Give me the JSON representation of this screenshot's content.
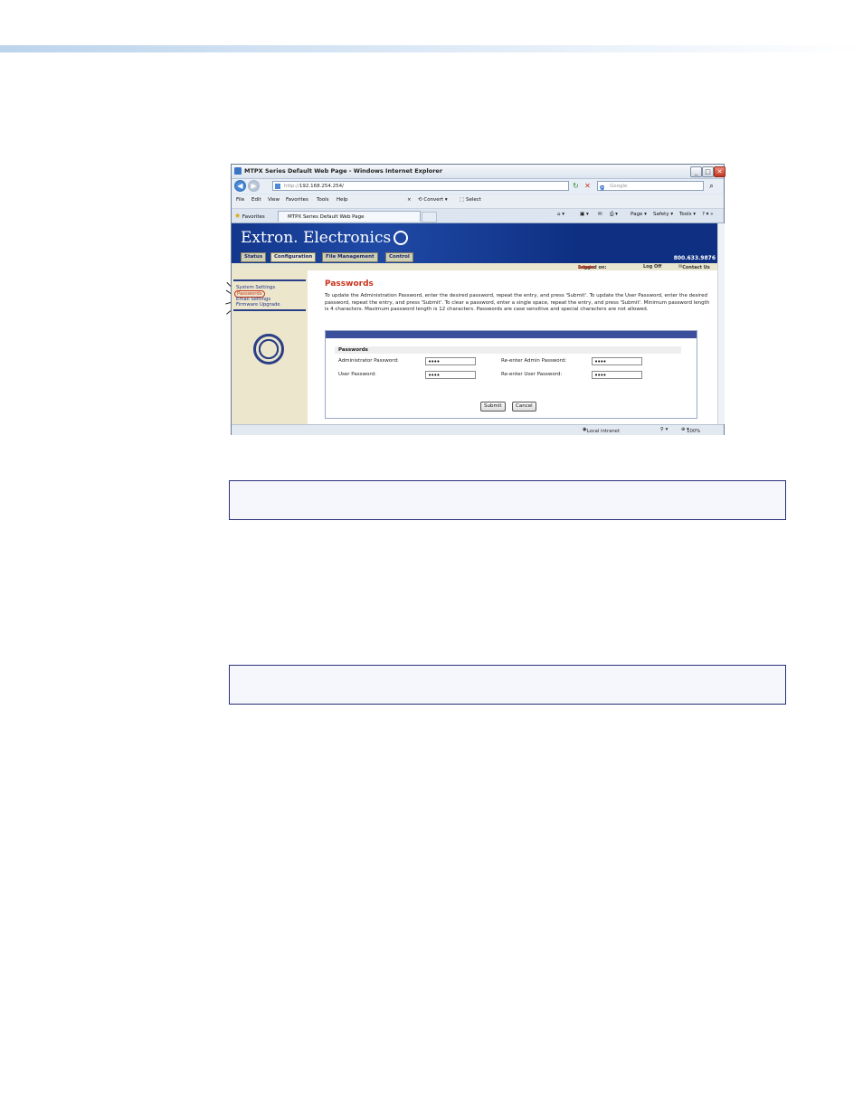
{
  "window": {
    "title": "MTPX Series Default Web Page - Windows Internet Explorer",
    "controls": {
      "minimize": "_",
      "maximize": "□",
      "close": "✕"
    }
  },
  "address_bar": {
    "url_prefix": "http://",
    "url": "192.168.254.254/",
    "search_placeholder": "Google"
  },
  "menu": {
    "items": [
      "File",
      "Edit",
      "View",
      "Favorites",
      "Tools",
      "Help"
    ],
    "convert_label": "Convert",
    "select_label": "Select"
  },
  "tabs": {
    "favorites_label": "Favorites",
    "active_tab": "MTPX Series Default Web Page",
    "commands": {
      "page": "Page ▾",
      "safety": "Safety ▾",
      "tools": "Tools ▾"
    }
  },
  "site": {
    "brand": "Extron. Electronics",
    "phone": "800.633.9876",
    "nav_tabs": [
      {
        "label": "Status",
        "active": false
      },
      {
        "label": "Configuration",
        "active": true
      },
      {
        "label": "File Management",
        "active": false
      },
      {
        "label": "Control",
        "active": false
      }
    ],
    "login": {
      "prefix": "Logged on:",
      "user": "Admin",
      "logoff": "Log Off",
      "contact": "Contact Us"
    }
  },
  "sidebar": {
    "links": [
      {
        "label": "System Settings",
        "current": false
      },
      {
        "label": "Passwords",
        "current": true
      },
      {
        "label": "Email Settings",
        "current": false
      },
      {
        "label": "Firmware Upgrade",
        "current": false
      }
    ]
  },
  "content": {
    "title": "Passwords",
    "description": "To update the Administration Password, enter the desired password, repeat the entry, and press 'Submit'.  To update the User Password, enter the desired password, repeat the entry, and press 'Submit'.  To clear a password, enter a single space, repeat the entry, and press 'Submit'.  Minimum password length is 4 characters.  Maximum password length is 12 characters.  Passwords are case sensitive and special characters are not allowed.",
    "form": {
      "section_title": "Passwords",
      "admin_label": "Administrator Password:",
      "admin_value": "••••",
      "admin_reenter_label": "Re-enter Admin Password:",
      "admin_reenter_value": "••••",
      "user_label": "User Password:",
      "user_value": "••••",
      "user_reenter_label": "Re-enter User Password:",
      "user_reenter_value": "••••",
      "submit": "Submit",
      "cancel": "Cancel"
    }
  },
  "statusbar": {
    "zone": "Local intranet",
    "zoom": "100%"
  }
}
